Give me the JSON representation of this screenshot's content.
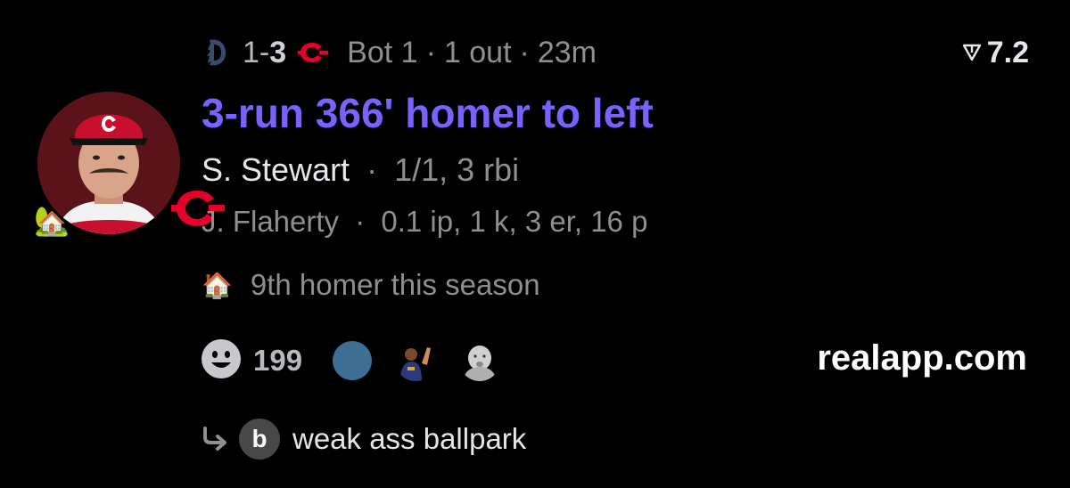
{
  "game": {
    "away_team_icon": "tigers-d-logo-icon",
    "away_score": "1",
    "score_dash": "-",
    "home_score": "3",
    "home_team_icon": "reds-c-logo-icon",
    "inning": "Bot 1",
    "outs": "1 out",
    "time_ago": "23m",
    "separator": "·"
  },
  "rating": {
    "icon": "triangle-flag-icon",
    "value": "7.2"
  },
  "play": {
    "title": "3-run 366' homer to left",
    "batter_name": "S. Stewart",
    "batter_stats": "1/1, 3 rbi",
    "pitcher_name": "J. Flaherty",
    "pitcher_stats": "0.1 ip, 1 k, 3 er, 16 p",
    "note_icon": "🏠",
    "note_text": "9th homer this season",
    "house_badge": "🏡"
  },
  "reactions": {
    "icon": "smiley-face-icon",
    "count": "199",
    "reactor_icons": [
      "blue-circle-avatar",
      "waving-person-avatar",
      "baby-avatar"
    ]
  },
  "site": {
    "link_text": "realapp.com"
  },
  "reply": {
    "avatar_letter": "b",
    "text": "weak ass ballpark"
  },
  "colors": {
    "accent": "#7b61ff",
    "background": "#000000",
    "reds_red": "#e4002b",
    "tigers_navy": "#394a6b",
    "muted": "#8e8e93"
  }
}
